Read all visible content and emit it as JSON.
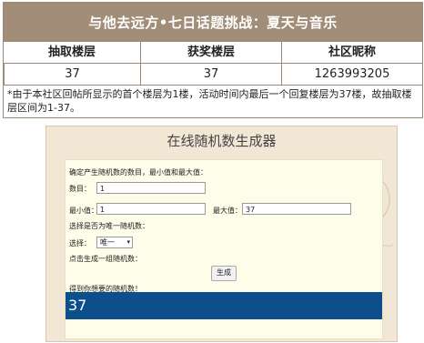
{
  "announcement": {
    "title": "与他去远方•七日话题挑战：夏天与音乐",
    "headers": [
      "抽取楼层",
      "获奖楼层",
      "社区昵称"
    ],
    "row": [
      "37",
      "37",
      "1263993205"
    ],
    "note": "*由于本社区回帖所显示的首个楼层为1楼，活动时间内最后一个回复楼层为37楼，故抽取楼层区间为1-37。"
  },
  "generator": {
    "title": "在线随机数生成器",
    "instruction": "确定产生随机数的数目，最小值和最大值：",
    "count_label": "数目：",
    "count_value": "1",
    "min_label": "最小值：",
    "min_value": "1",
    "max_label": "最大值：",
    "max_value": "37",
    "unique_prompt": "选择是否为唯一随机数：",
    "select_label": "选择：",
    "select_value": "唯一",
    "click_prompt": "点击生成一组随机数：",
    "generate_button": "生成",
    "result_prompt": "得到你想要的随机数！",
    "result_value": "37"
  }
}
